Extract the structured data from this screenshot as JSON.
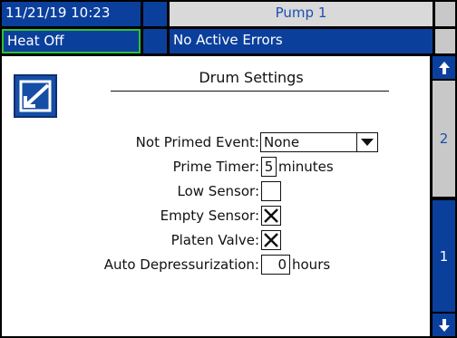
{
  "header": {
    "datetime": "11/21/19 10:23",
    "pump_name": "Pump 1",
    "heat_status": "Heat Off",
    "error_status": "No Active Errors"
  },
  "screen": {
    "title": "Drum Settings",
    "edit_icon": "edit-pencil-icon",
    "fields": {
      "not_primed_event": {
        "label": "Not Primed Event:",
        "value": "None",
        "options_visible": [
          "None"
        ]
      },
      "prime_timer": {
        "label": "Prime Timer:",
        "value": "5",
        "unit": "minutes"
      },
      "low_sensor": {
        "label": "Low Sensor:",
        "checked": false
      },
      "empty_sensor": {
        "label": "Empty Sensor:",
        "checked": true
      },
      "platen_valve": {
        "label": "Platen Valve:",
        "checked": true
      },
      "auto_depressurization": {
        "label": "Auto Depressurization:",
        "value": "0",
        "unit": "hours"
      }
    }
  },
  "nav": {
    "up_icon": "arrow-up-icon",
    "down_icon": "arrow-down-icon",
    "pages": [
      {
        "label": "2"
      },
      {
        "label": "1"
      }
    ]
  },
  "colors": {
    "header_blue": "#0b3f9c",
    "selection_green": "#2ec235",
    "gray_panel": "#c8c8c8"
  }
}
